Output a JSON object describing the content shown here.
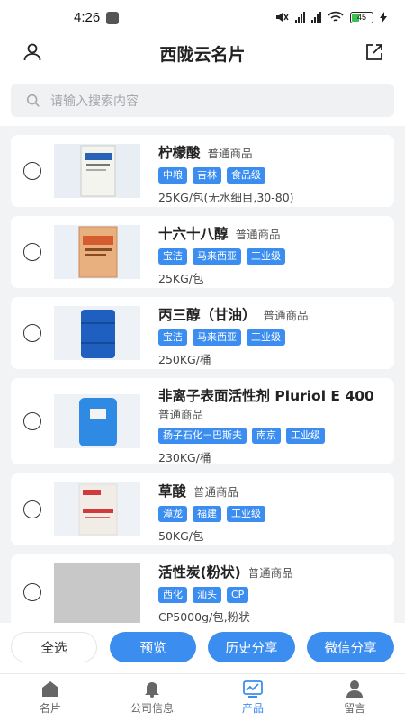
{
  "status": {
    "time": "4:26",
    "battery": "45"
  },
  "header": {
    "title": "西陇云名片"
  },
  "search": {
    "placeholder": "请输入搜索内容"
  },
  "products": [
    {
      "name": "柠檬酸",
      "type": "普通商品",
      "tags": [
        "中粮",
        "吉林",
        "食品级"
      ],
      "spec": "25KG/包(无水细目,30-80)"
    },
    {
      "name": "十六十八醇",
      "type": "普通商品",
      "tags": [
        "宝洁",
        "马来西亚",
        "工业级"
      ],
      "spec": "25KG/包"
    },
    {
      "name": "丙三醇（甘油）",
      "type": "普通商品",
      "tags": [
        "宝洁",
        "马来西亚",
        "工业级"
      ],
      "spec": "250KG/桶"
    },
    {
      "name": "非离子表面活性剂 Pluriol E 400",
      "type": "普通商品",
      "tags": [
        "扬子石化－巴斯夫",
        "南京",
        "工业级"
      ],
      "spec": "230KG/桶"
    },
    {
      "name": "草酸",
      "type": "普通商品",
      "tags": [
        "漳龙",
        "福建",
        "工业级"
      ],
      "spec": "50KG/包"
    },
    {
      "name": "活性炭(粉状)",
      "type": "普通商品",
      "tags": [
        "西化",
        "汕头",
        "CP"
      ],
      "spec": "CP5000g/包,粉状"
    }
  ],
  "actions": {
    "select_all": "全选",
    "preview": "预览",
    "history_share": "历史分享",
    "wechat_share": "微信分享"
  },
  "tabs": [
    {
      "label": "名片",
      "icon": "home-icon"
    },
    {
      "label": "公司信息",
      "icon": "bell-icon"
    },
    {
      "label": "产品",
      "icon": "chart-icon"
    },
    {
      "label": "留言",
      "icon": "person-icon"
    }
  ],
  "colors": {
    "accent": "#3c8df0",
    "background": "#f2f3f5"
  }
}
